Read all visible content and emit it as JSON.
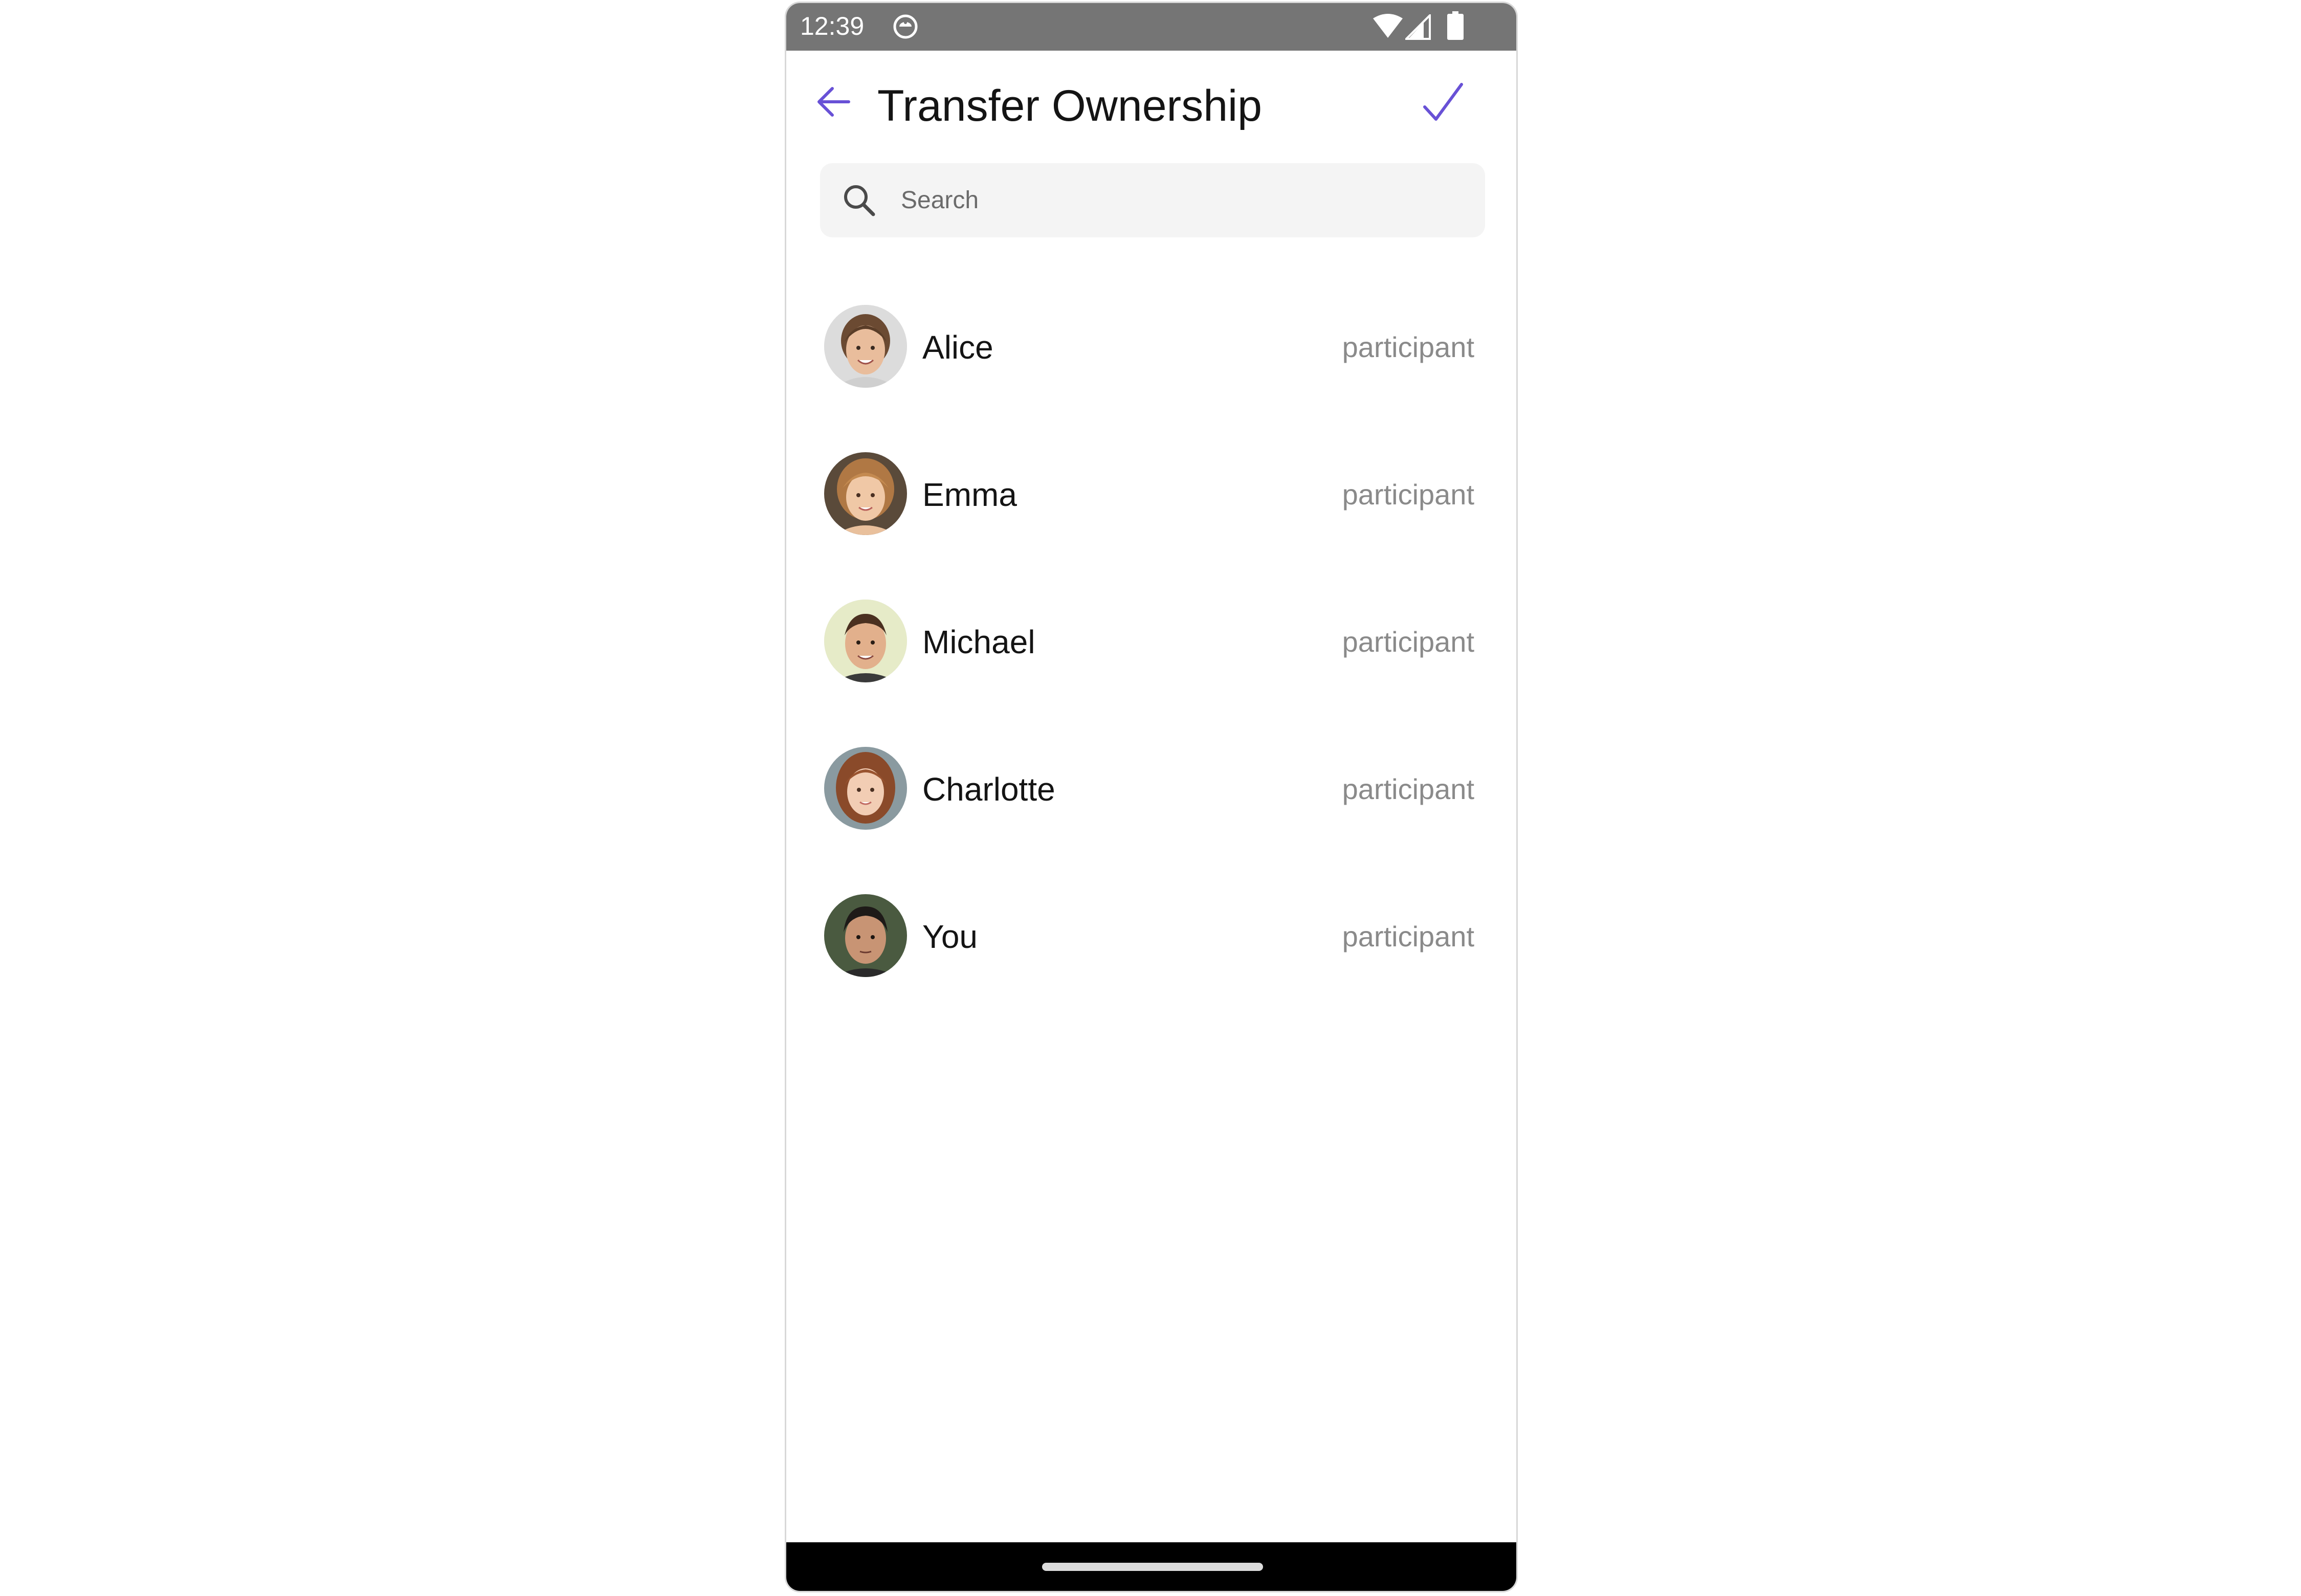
{
  "status_bar": {
    "time": "12:39",
    "icons": [
      "app-notification-icon",
      "wifi-icon",
      "cellular-signal-icon",
      "battery-icon"
    ]
  },
  "header": {
    "title": "Transfer Ownership",
    "back_icon": "arrow-left-icon",
    "confirm_icon": "checkmark-icon",
    "accent_color": "#6851D6"
  },
  "search": {
    "placeholder": "Search",
    "value": "",
    "icon": "search-icon"
  },
  "members": [
    {
      "name": "Alice",
      "role": "participant"
    },
    {
      "name": "Emma",
      "role": "participant"
    },
    {
      "name": "Michael",
      "role": "participant"
    },
    {
      "name": "Charlotte",
      "role": "participant"
    },
    {
      "name": "You",
      "role": "participant"
    }
  ]
}
